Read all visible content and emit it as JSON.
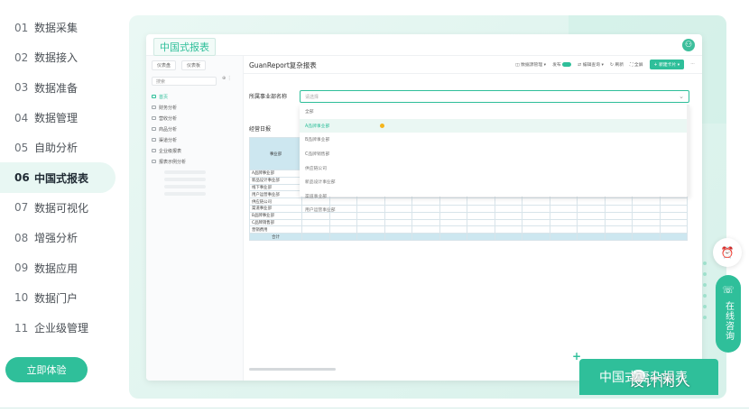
{
  "menu": [
    {
      "num": "01",
      "label": "数据采集"
    },
    {
      "num": "02",
      "label": "数据接入"
    },
    {
      "num": "03",
      "label": "数据准备"
    },
    {
      "num": "04",
      "label": "数据管理"
    },
    {
      "num": "05",
      "label": "自助分析"
    },
    {
      "num": "06",
      "label": "中国式报表"
    },
    {
      "num": "07",
      "label": "数据可视化"
    },
    {
      "num": "08",
      "label": "增强分析"
    },
    {
      "num": "09",
      "label": "数据应用"
    },
    {
      "num": "10",
      "label": "数据门户"
    },
    {
      "num": "11",
      "label": "企业级管理"
    }
  ],
  "cta_label": "立即体验",
  "window": {
    "title": "中国式报表",
    "avatar": "⚇",
    "side": {
      "tab1": "仪表盘",
      "tab2": "仪表板",
      "search_placeholder": "搜索",
      "search_action": "⊕ ⋮",
      "tree": [
        "首页",
        "财务分析",
        "营收分析",
        "商品分析",
        "渠道分析",
        "企业级报表",
        "报表示例分析"
      ]
    },
    "report_title": "GuanReport复杂报表",
    "toolbar": {
      "item1": "◫ 数据源管理 ▾",
      "item2": "发布",
      "item3": "⇄ 编辑查询 ▾",
      "item4": "↻ 刷新",
      "item5": "⛶ 全屏",
      "new_card": "+ 新建卡片 ▾",
      "more": "⋯"
    },
    "filter_label": "所属事业部名称",
    "select_placeholder": "请选择",
    "dropdown": [
      "全部",
      "A品牌事业部",
      "B品牌事业部",
      "C品牌销售部",
      "供应链公司",
      "新品设计事业部",
      "渠道事业部",
      "用户运营事业部"
    ],
    "sub_title": "经营日报",
    "table_header": "事业部",
    "table_rows": [
      "A品牌事业部",
      "新品设计事业部",
      "线下事业部",
      "用户运营事业部",
      "供应链公司",
      "渠道事业部",
      "B品牌事业部",
      "C品牌销售部",
      "营销费用"
    ],
    "table_total": "合计"
  },
  "widgets": {
    "clock_icon": "⏰",
    "phone_icon": "☏",
    "consult_label": "在线咨询",
    "plus": "+"
  },
  "card_text": "中国式复杂报表",
  "watermark_text": "设计闲人"
}
